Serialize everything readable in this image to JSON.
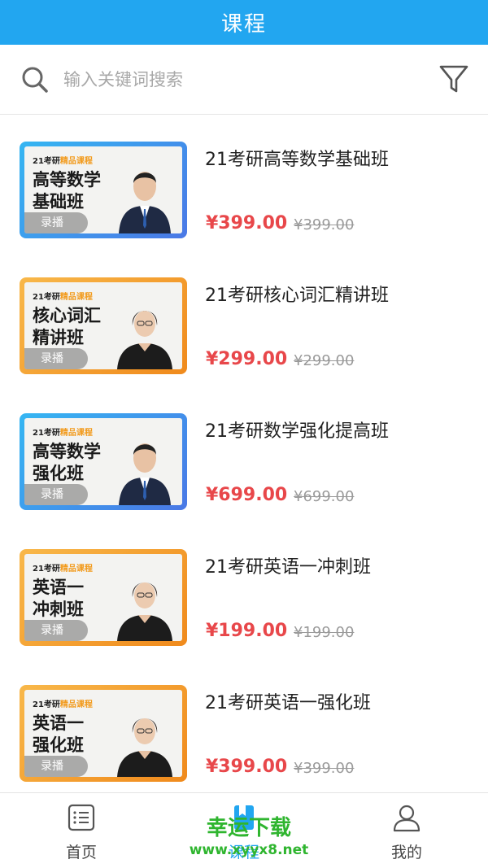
{
  "header": {
    "title": "课程"
  },
  "search": {
    "placeholder": "输入关键词搜索",
    "value": ""
  },
  "courses": [
    {
      "title": "21考研高等数学基础班",
      "price": "¥399.00",
      "original_price": "¥399.00",
      "thumb_tag_prefix": "21考研",
      "thumb_tag_highlight": "精品课程",
      "thumb_line1": "高等数学",
      "thumb_line2": "基础班",
      "badge": "录播",
      "theme": "blue"
    },
    {
      "title": "21考研核心词汇精讲班",
      "price": "¥299.00",
      "original_price": "¥299.00",
      "thumb_tag_prefix": "21考研",
      "thumb_tag_highlight": "精品课程",
      "thumb_line1": "核心词汇",
      "thumb_line2": "精讲班",
      "badge": "录播",
      "theme": "orange"
    },
    {
      "title": "21考研数学强化提高班",
      "price": "¥699.00",
      "original_price": "¥699.00",
      "thumb_tag_prefix": "21考研",
      "thumb_tag_highlight": "精品课程",
      "thumb_line1": "高等数学",
      "thumb_line2": "强化班",
      "badge": "录播",
      "theme": "blue"
    },
    {
      "title": "21考研英语一冲刺班",
      "price": "¥199.00",
      "original_price": "¥199.00",
      "thumb_tag_prefix": "21考研",
      "thumb_tag_highlight": "精品课程",
      "thumb_line1": "英语一",
      "thumb_line2": "冲刺班",
      "badge": "录播",
      "theme": "orange"
    },
    {
      "title": "21考研英语一强化班",
      "price": "¥399.00",
      "original_price": "¥399.00",
      "thumb_tag_prefix": "21考研",
      "thumb_tag_highlight": "精品课程",
      "thumb_line1": "英语一",
      "thumb_line2": "强化班",
      "badge": "录播",
      "theme": "orange"
    }
  ],
  "tabbar": {
    "items": [
      {
        "label": "首页",
        "icon": "list-icon"
      },
      {
        "label": "课程",
        "icon": "bookmark-icon",
        "active": true
      },
      {
        "label": "我的",
        "icon": "user-icon"
      }
    ]
  },
  "watermark": {
    "line1": "幸运下载",
    "line2": "www.xyyx8.net"
  },
  "colors": {
    "accent": "#22a6f0",
    "price": "#e8474a",
    "watermark": "#2fb52f"
  }
}
